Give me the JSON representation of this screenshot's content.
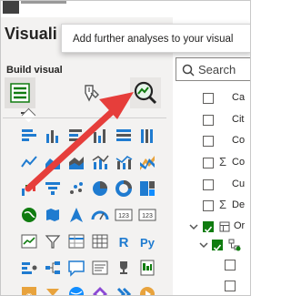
{
  "pane": {
    "title": "Visuali",
    "build_label": "Build visual"
  },
  "tooltip": {
    "text": "Add further analyses to your visual"
  },
  "search": {
    "placeholder": "Search"
  },
  "fields": [
    {
      "label": "Ca",
      "checked": false,
      "sigma": false
    },
    {
      "label": "Cit",
      "checked": false,
      "sigma": false
    },
    {
      "label": "Co",
      "checked": false,
      "sigma": false
    },
    {
      "label": "Co",
      "checked": false,
      "sigma": true
    },
    {
      "label": "Cu",
      "checked": false,
      "sigma": false
    },
    {
      "label": "De",
      "checked": false,
      "sigma": true
    },
    {
      "label": "Or",
      "checked": true,
      "sigma": false
    }
  ],
  "visual_text": {
    "r_label": "R",
    "py_label": "Py",
    "kpi_label": "123",
    "kpi_label_2": "123"
  },
  "colors": {
    "accent_green": "#107c10",
    "arrow_red": "#e63e3b",
    "icon_blue": "#1f7bd0",
    "icon_teal": "#118dff",
    "icon_orange": "#e8a33d"
  }
}
